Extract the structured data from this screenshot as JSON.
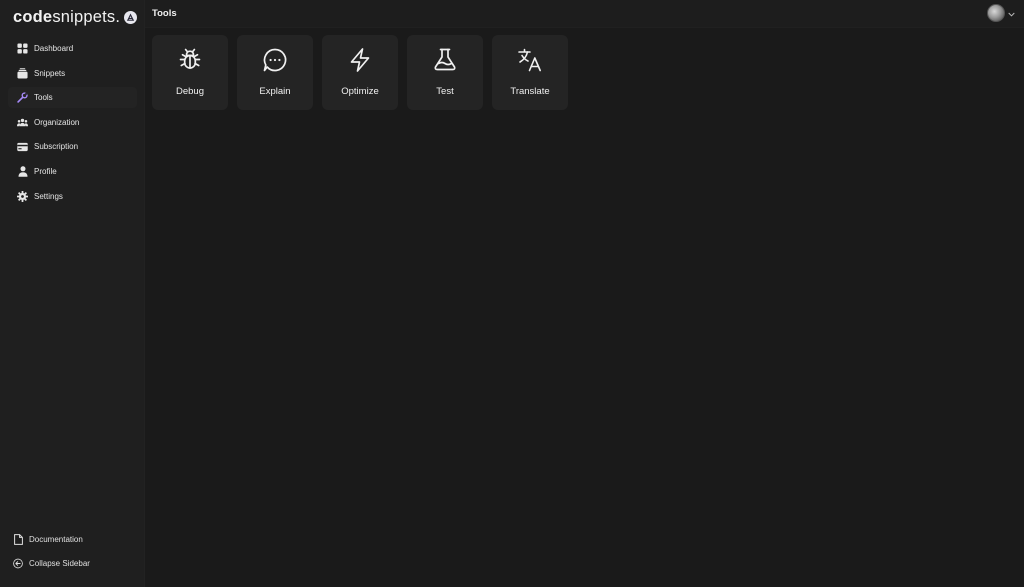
{
  "brand": {
    "logo_bold": "code",
    "logo_rest": "snippets."
  },
  "header": {
    "title": "Tools"
  },
  "sidebar": {
    "items": [
      {
        "label": "Dashboard",
        "icon": "grid-icon"
      },
      {
        "label": "Snippets",
        "icon": "stack-icon"
      },
      {
        "label": "Tools",
        "icon": "wrench-icon",
        "active": true
      },
      {
        "label": "Organization",
        "icon": "users-icon"
      },
      {
        "label": "Subscription",
        "icon": "credit-card-icon"
      },
      {
        "label": "Profile",
        "icon": "user-icon"
      },
      {
        "label": "Settings",
        "icon": "gear-icon"
      }
    ],
    "bottom": [
      {
        "label": "Documentation",
        "icon": "document-icon"
      },
      {
        "label": "Collapse Sidebar",
        "icon": "arrow-left-circle-icon"
      }
    ]
  },
  "tools": [
    {
      "label": "Debug",
      "icon": "bug-icon"
    },
    {
      "label": "Explain",
      "icon": "chat-bubble-icon"
    },
    {
      "label": "Optimize",
      "icon": "lightning-icon"
    },
    {
      "label": "Test",
      "icon": "flask-icon"
    },
    {
      "label": "Translate",
      "icon": "translate-icon"
    }
  ],
  "colors": {
    "background": "#1a1a1a",
    "sidebar": "#1f1f1f",
    "card": "#242424",
    "accent": "#8b5cf6"
  }
}
